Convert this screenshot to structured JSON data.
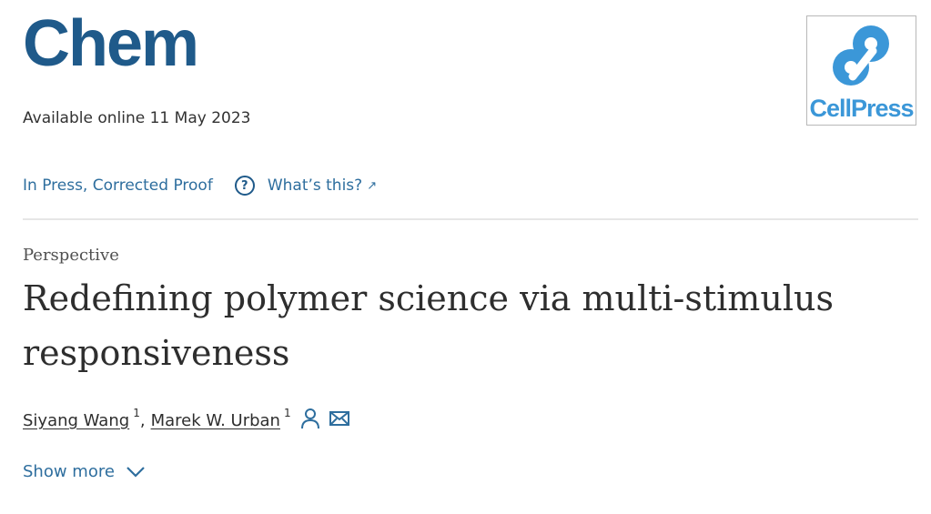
{
  "header": {
    "journal_title": "Chem",
    "publisher_logo_text": "CellPress"
  },
  "publication": {
    "available_online": "Available online 11 May 2023",
    "status": "In Press, Corrected Proof",
    "help_icon_glyph": "?",
    "whats_this_label": "What’s this?",
    "external_icon_glyph": "↗"
  },
  "article": {
    "type": "Perspective",
    "title": "Redefining polymer science via multi-stimulus responsiveness"
  },
  "authors": [
    {
      "name": "Siyang Wang",
      "affiliation": "1"
    },
    {
      "name": "Marek W. Urban",
      "affiliation": "1"
    }
  ],
  "show_more_label": "Show more",
  "colors": {
    "brand": "#1f5a8a",
    "link": "#2e6e9e",
    "cellpress_blue": "#3b97d8"
  },
  "icons": [
    "help-icon",
    "external-link-icon",
    "person-icon",
    "mail-icon",
    "chevron-down-icon"
  ]
}
